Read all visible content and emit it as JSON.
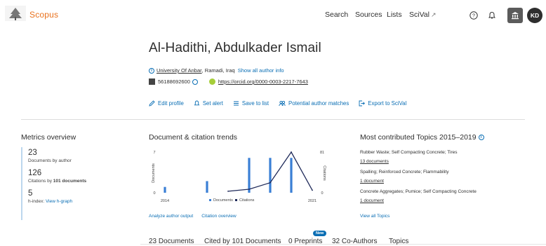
{
  "header": {
    "brand": "Scopus",
    "nav": {
      "search": "Search",
      "sources": "Sources",
      "lists": "Lists",
      "scival": "SciVal",
      "scival_ext": "↗"
    },
    "avatar_initials": "KD",
    "icons": [
      "help-icon",
      "bell-icon",
      "institution-icon"
    ]
  },
  "author": {
    "name": "Al-Hadithi, Abdulkader Ismail",
    "affiliation_link": "University Of Anbar",
    "affiliation_rest": ", Ramadi, Iraq",
    "show_all": "Show all author info",
    "scopus_id": "56188692600",
    "orcid": "https://orcid.org/0000-0003-2217-7643"
  },
  "actions": {
    "edit_profile": "Edit profile",
    "set_alert": "Set alert",
    "save_to_list": "Save to list",
    "potential_matches": "Potential author matches",
    "export_scival": "Export to SciVal"
  },
  "metrics": {
    "title": "Metrics overview",
    "documents_value": "23",
    "documents_label": "Documents by author",
    "citations_value": "126",
    "citations_label_prefix": "Citations by ",
    "citations_label_bold": "101 documents",
    "hindex_value": "5",
    "hindex_label": "h-index:",
    "hindex_link": "View h-graph"
  },
  "trends": {
    "title": "Document & citation trends",
    "analyze_link": "Analyze author output",
    "citation_link": "Citation overview"
  },
  "chart_data": {
    "type": "bar",
    "title": "Document & citation trends",
    "x": [
      2014,
      2015,
      2016,
      2017,
      2018,
      2019,
      2020,
      2021
    ],
    "xtick_labels": [
      "2014",
      "2021"
    ],
    "y_left_label": "Documents",
    "y_left_ticks": [
      "7",
      "0"
    ],
    "y_right_label": "Citations",
    "y_right_ticks": [
      "81",
      "0"
    ],
    "ylim_left": [
      0,
      7
    ],
    "ylim_right": [
      0,
      81
    ],
    "series": [
      {
        "name": "Documents",
        "type": "bar",
        "color": "#3a7fd5",
        "values": [
          1,
          0,
          2,
          0,
          6,
          6,
          6,
          0
        ]
      },
      {
        "name": "Citations",
        "type": "line",
        "color": "#1f2a5a",
        "values": [
          null,
          null,
          null,
          3,
          7,
          20,
          81,
          5
        ]
      }
    ],
    "legend": [
      "Documents",
      "Citations"
    ],
    "legend_position": "bottom"
  },
  "topics": {
    "title": "Most contributed Topics 2015–2019",
    "items": [
      {
        "name": "Rubber Waste; Self Compacting Concrete; Tires",
        "docs": "13 documents"
      },
      {
        "name": "Spalling; Reinforced Concrete; Flammability",
        "docs": "1 document"
      },
      {
        "name": "Concrete Aggregates; Pumice; Self Compacting Concrete",
        "docs": "1 document"
      }
    ],
    "view_all": "View all Topics"
  },
  "tabs": {
    "documents": "23 Documents",
    "cited_by": "Cited by 101 Documents",
    "preprints": "0 Preprints",
    "new_badge": "New",
    "coauthors": "32 Co-Authors",
    "topics": "Topics"
  },
  "colors": {
    "brand": "#e9711c",
    "link": "#0a6eb4",
    "bar": "#3a7fd5",
    "line": "#1f2a5a"
  }
}
